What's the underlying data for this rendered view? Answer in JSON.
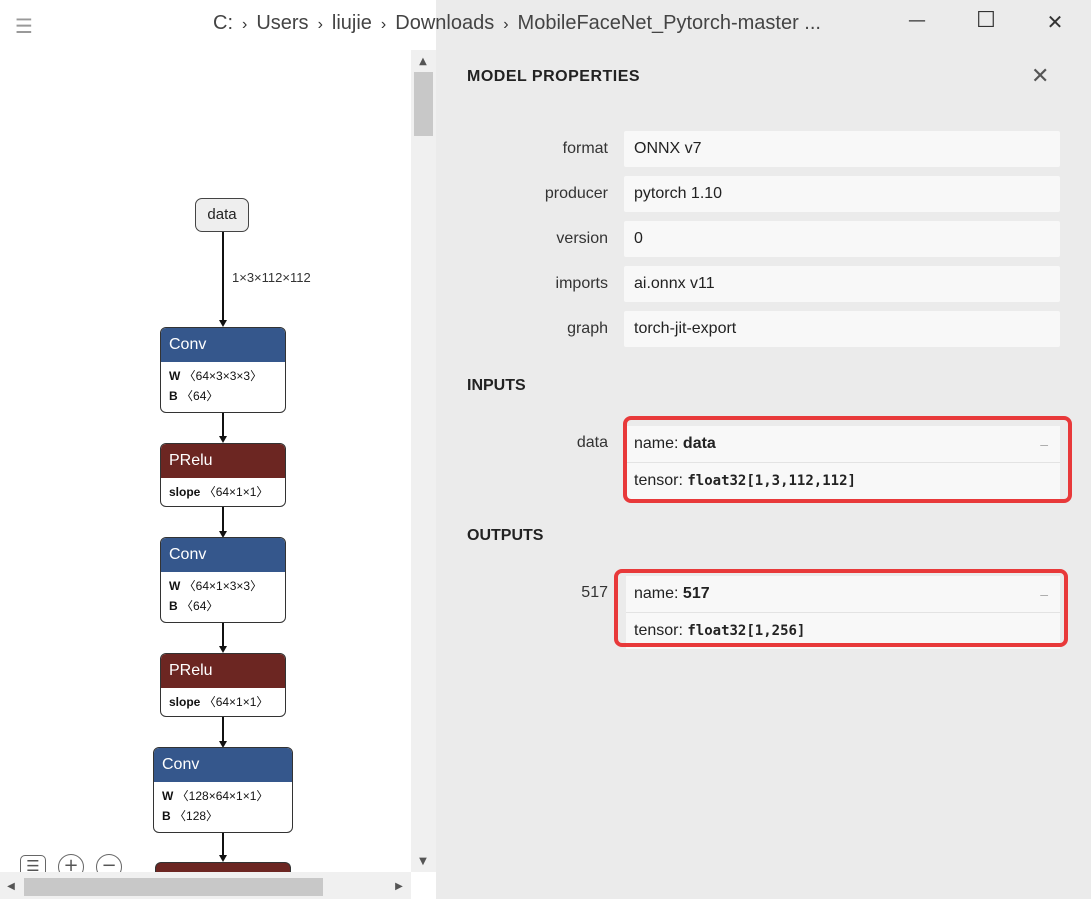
{
  "breadcrumb": {
    "items": [
      "C:",
      "Users",
      "liujie",
      "Downloads",
      "MobileFaceNet_Pytorch-master ..."
    ],
    "separator": "›"
  },
  "window_controls": {
    "minimize": "—",
    "maximize": "☐",
    "close": "✕"
  },
  "graph": {
    "input_node": "data",
    "edge_label": "1×3×112×112",
    "nodes": [
      {
        "op": "Conv",
        "attrs": [
          {
            "k": "W",
            "v": "〈64×3×3×3〉"
          },
          {
            "k": "B",
            "v": "〈64〉"
          }
        ]
      },
      {
        "op": "PRelu",
        "attrs": [
          {
            "k": "slope",
            "v": "〈64×1×1〉"
          }
        ]
      },
      {
        "op": "Conv",
        "attrs": [
          {
            "k": "W",
            "v": "〈64×1×3×3〉"
          },
          {
            "k": "B",
            "v": "〈64〉"
          }
        ]
      },
      {
        "op": "PRelu",
        "attrs": [
          {
            "k": "slope",
            "v": "〈64×1×1〉"
          }
        ]
      },
      {
        "op": "Conv",
        "attrs": [
          {
            "k": "W",
            "v": "〈128×64×1×1〉"
          },
          {
            "k": "B",
            "v": "〈128〉"
          }
        ]
      }
    ],
    "colors": {
      "conv": "#35578c",
      "prelu": "#6c2622"
    }
  },
  "panel": {
    "title": "MODEL PROPERTIES",
    "close_icon": "✕",
    "properties": [
      {
        "label": "format",
        "value": "ONNX v7"
      },
      {
        "label": "producer",
        "value": "pytorch 1.10"
      },
      {
        "label": "version",
        "value": "0"
      },
      {
        "label": "imports",
        "value": "ai.onnx v11"
      },
      {
        "label": "graph",
        "value": "torch-jit-export"
      }
    ],
    "inputs_title": "INPUTS",
    "input": {
      "label": "data",
      "name_prefix": "name: ",
      "name": "data",
      "tensor_prefix": "tensor: ",
      "tensor": "float32[1,3,112,112]",
      "toggle": "–"
    },
    "outputs_title": "OUTPUTS",
    "output": {
      "label": "517",
      "name_prefix": "name: ",
      "name": "517",
      "tensor_prefix": "tensor: ",
      "tensor": "float32[1,256]",
      "toggle": "–"
    },
    "highlight_color": "#e8393a"
  },
  "controls": {
    "list_icon": "☰",
    "zoom_in": "+",
    "zoom_out": "−"
  },
  "hamburger": "☰"
}
